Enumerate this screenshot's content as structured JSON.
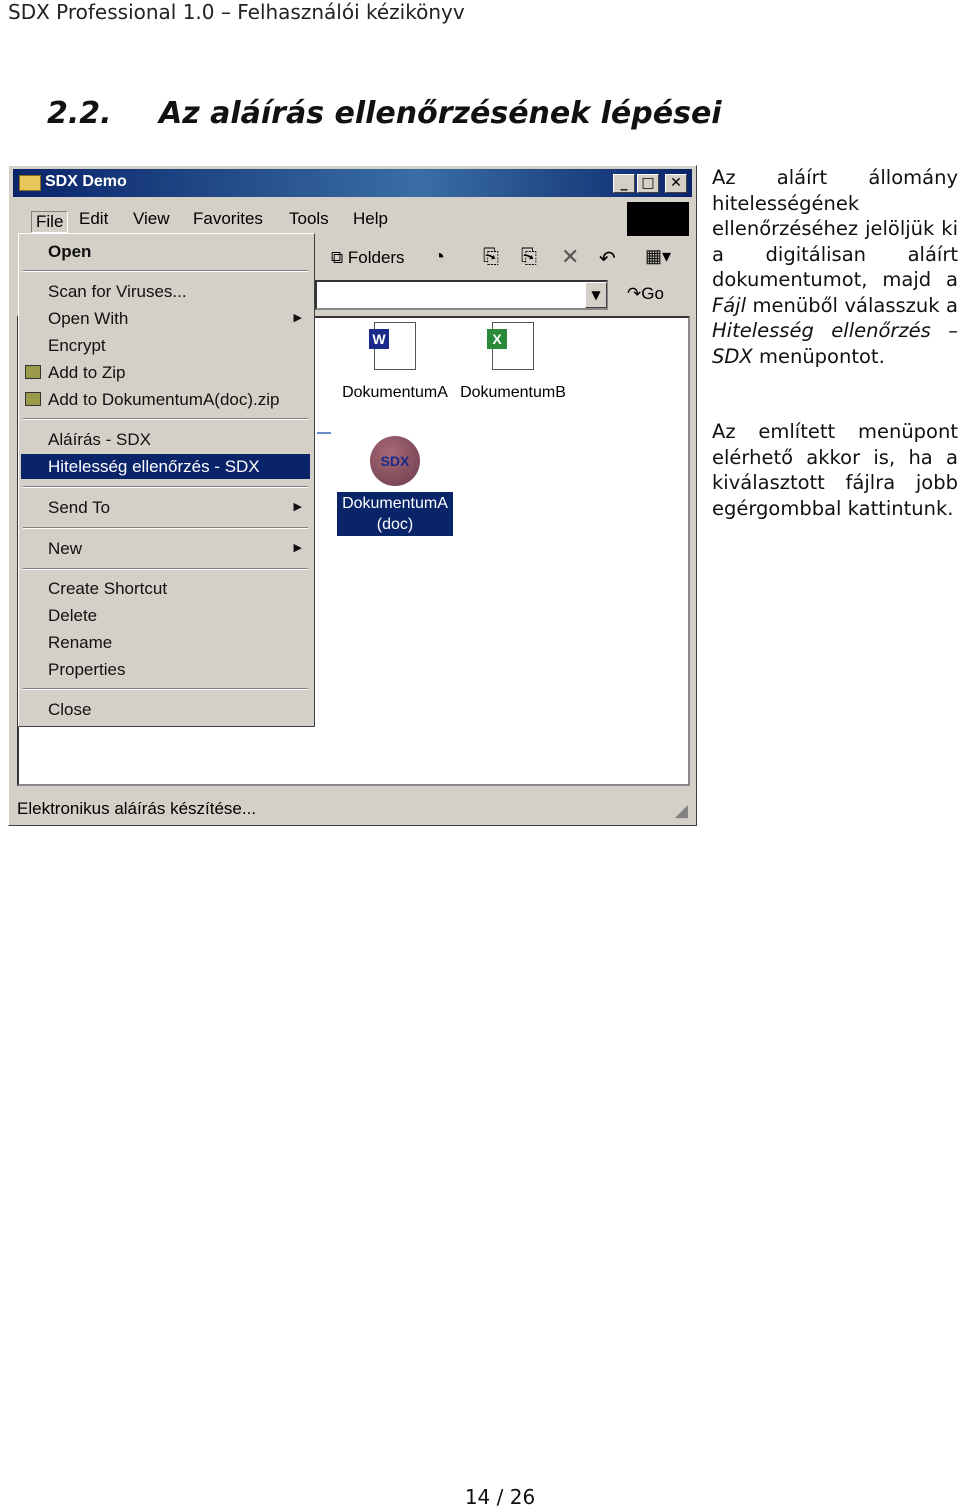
{
  "running_header": "SDX Professional 1.0 – Felhasználói kézikönyv",
  "heading": {
    "number": "2.2.",
    "title": "Az aláírás ellenőrzésének lépései"
  },
  "window": {
    "title": "SDX Demo",
    "menubar": [
      "File",
      "Edit",
      "View",
      "Favorites",
      "Tools",
      "Help"
    ],
    "toolbar": {
      "folders": "Folders",
      "go": "Go"
    },
    "file_menu": [
      {
        "label": "Open",
        "bold": true
      },
      {
        "label": "Scan for Viruses..."
      },
      {
        "label": "Open With",
        "submenu": true
      },
      {
        "label": "Encrypt"
      },
      {
        "label": "Add to Zip",
        "icon": "zip-icon"
      },
      {
        "label": "Add to DokumentumA(doc).zip",
        "icon": "zip-icon"
      },
      {
        "label": "Aláírás - SDX"
      },
      {
        "label": "Hitelesség ellenőrzés - SDX",
        "selected": true
      },
      {
        "label": "Send To",
        "submenu": true
      },
      {
        "label": "New",
        "submenu": true
      },
      {
        "label": "Create Shortcut"
      },
      {
        "label": "Delete"
      },
      {
        "label": "Rename"
      },
      {
        "label": "Properties"
      },
      {
        "label": "Close"
      }
    ],
    "files": [
      {
        "name": "DokumentumA",
        "icon": "word-document-icon"
      },
      {
        "name": "DokumentumB",
        "icon": "excel-document-icon"
      },
      {
        "name": "DokumentumA",
        "name2": "(doc)",
        "icon": "sdx-icon",
        "selected": true
      }
    ],
    "status": "Elektronikus aláírás készítése..."
  },
  "paragraphs": {
    "p1": [
      "Az aláírt állomány hitelességének ellenőrzéséhez jelöljük ki a digitálisan aláírt dokumentumot, majd a ",
      "Fájl",
      " menüből válasszuk a ",
      "Hitelesség ellenőrzés – SDX",
      " menüpontot."
    ],
    "p2": "Az említett menüpont elérhető akkor is, ha a kiválasztott fájlra jobb egérgombbal kattintunk."
  },
  "page_number": "14 / 26",
  "colors": {
    "titlebar": "#0a246a",
    "selection": "#0a246a",
    "chrome": "#d4d0c8"
  }
}
